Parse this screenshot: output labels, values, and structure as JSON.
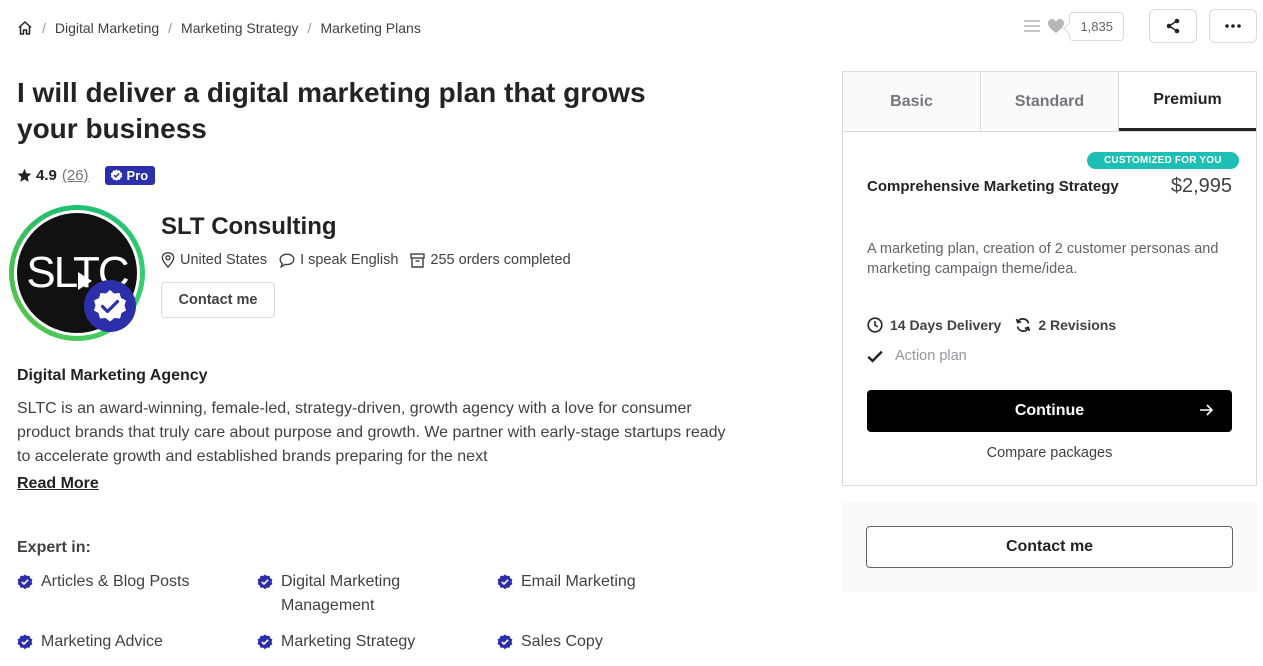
{
  "breadcrumb": {
    "items": [
      "Digital Marketing",
      "Marketing Strategy",
      "Marketing Plans"
    ],
    "separator": "/"
  },
  "actions": {
    "like_count": "1,835",
    "icons": [
      "collections-icon",
      "heart-icon",
      "share-icon",
      "more-icon"
    ]
  },
  "gig": {
    "title": "I will deliver a digital marketing plan that grows your business",
    "rating": "4.9",
    "review_count": "(26)",
    "pro_label": "Pro"
  },
  "seller": {
    "avatar_text": "SLTC",
    "name": "SLT Consulting",
    "country": "United States",
    "language": "I speak English",
    "orders": "255 orders completed",
    "contact_label": "Contact me"
  },
  "about": {
    "heading": "Digital Marketing Agency",
    "description": "SLTC is an award-winning, female-led, strategy-driven, growth agency with a love for consumer product brands that truly care about purpose and growth. We partner with early-stage startups ready to accelerate growth and established brands preparing for the next",
    "read_more": "Read More"
  },
  "expertise": {
    "heading": "Expert in:",
    "items": [
      "Articles & Blog Posts",
      "Digital Marketing Management",
      "Email Marketing",
      "Marketing Advice",
      "Marketing Strategy",
      "Sales Copy"
    ]
  },
  "package": {
    "tabs": [
      "Basic",
      "Standard",
      "Premium"
    ],
    "active_tab": "Premium",
    "badge": "CUSTOMIZED FOR YOU",
    "name": "Comprehensive Marketing Strategy",
    "price": "$2,995",
    "description": "A marketing plan, creation of 2 customer personas and marketing campaign theme/idea.",
    "delivery": "14 Days Delivery",
    "revisions": "2 Revisions",
    "includes": [
      "Action plan"
    ],
    "continue_label": "Continue",
    "compare_label": "Compare packages"
  },
  "contact_panel": {
    "label": "Contact me"
  },
  "colors": {
    "pro_badge": "#2b2fa9",
    "customized_badge": "#1dbeb4",
    "continue_bg": "#000000"
  }
}
